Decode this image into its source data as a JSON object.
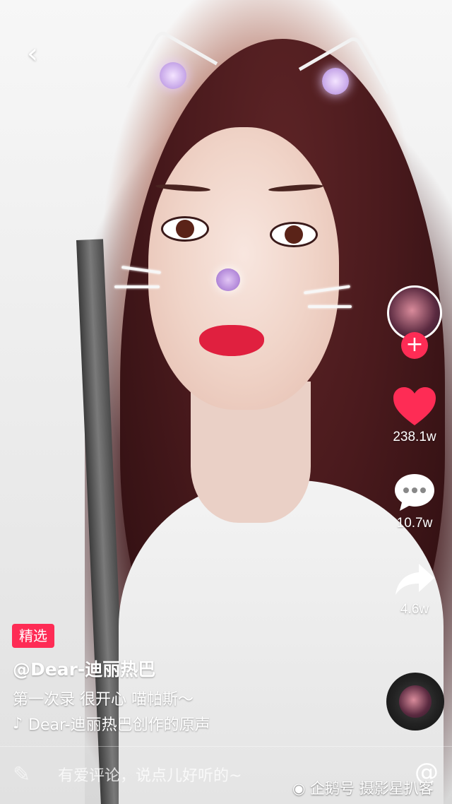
{
  "video": {
    "tag": "精选",
    "author": "@Dear-迪丽热巴",
    "description": "第一次录 很开心 喵帕斯～",
    "music": "Dear-迪丽热巴创作的原声"
  },
  "actions": {
    "likes": "238.1w",
    "comments": "10.7w",
    "shares": "4.6w",
    "follow_label": "+"
  },
  "comment_bar": {
    "placeholder": "有爱评论，说点儿好听的~"
  },
  "watermark": "企鹅号 摄影星扒客",
  "colors": {
    "accent": "#fe2c55",
    "text": "#ffffff"
  },
  "icons": [
    "back-chevron-icon",
    "heart-icon",
    "comment-bubble-icon",
    "share-arrow-icon",
    "music-note-icon",
    "pencil-icon",
    "at-sign-icon",
    "penguin-icon"
  ]
}
